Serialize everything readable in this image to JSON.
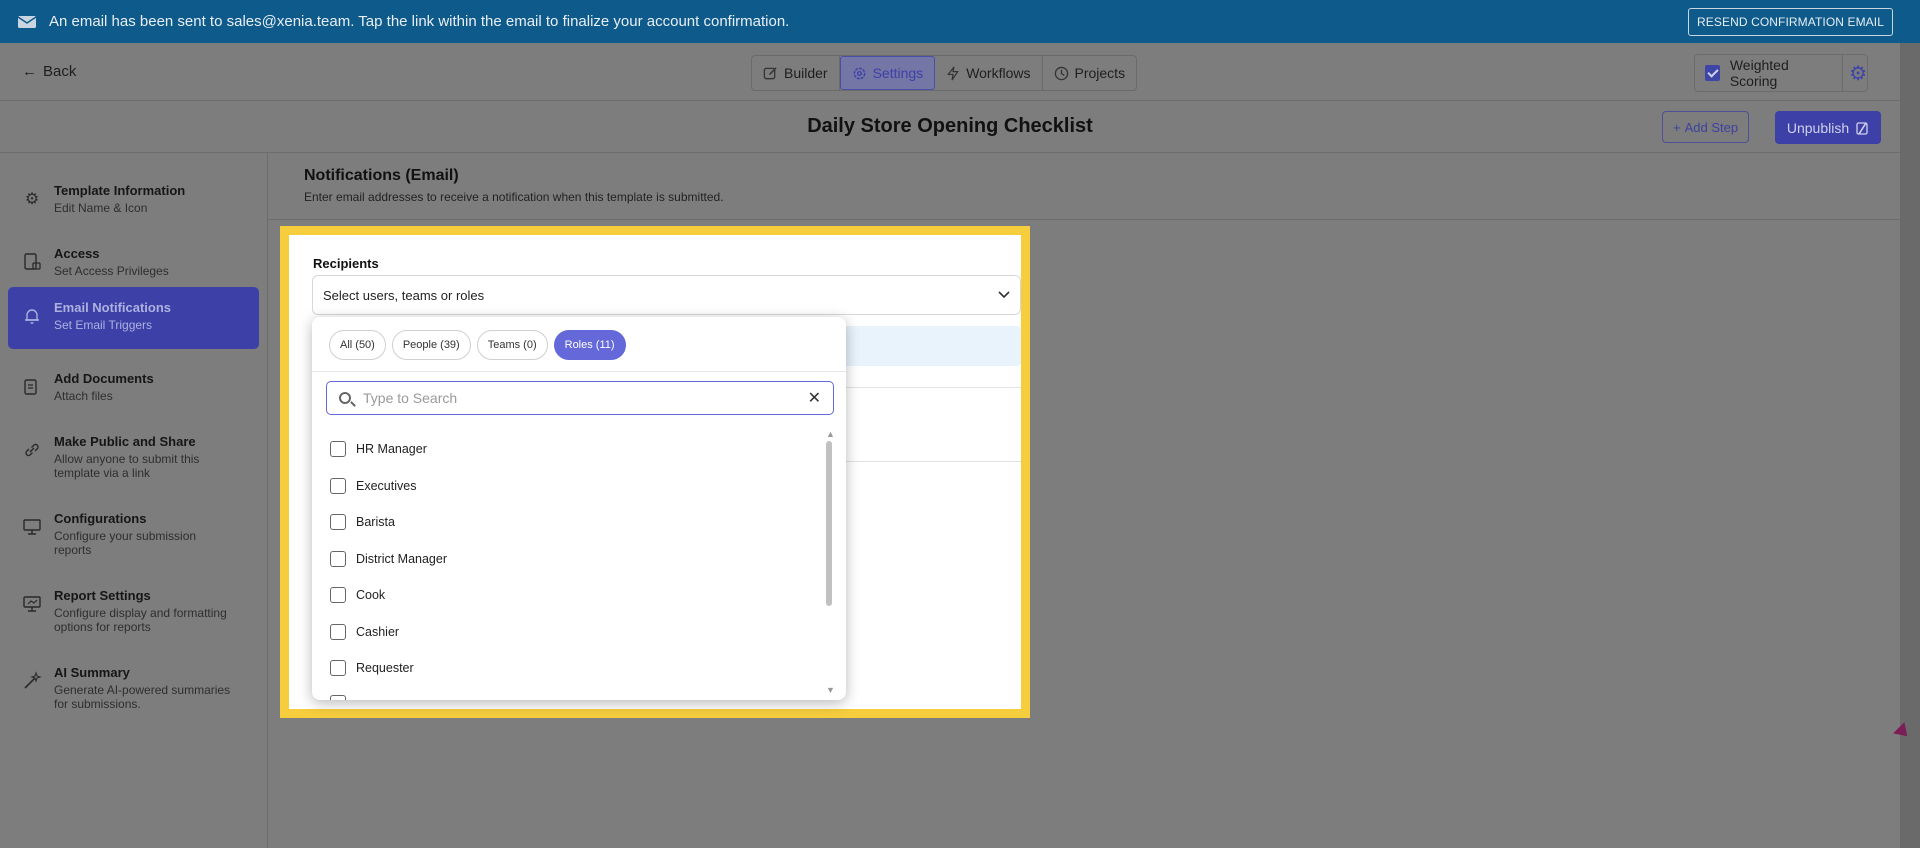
{
  "banner": {
    "message": "An email has been sent to sales@xenia.team. Tap the link within the email to finalize your account confirmation.",
    "resend_label": "RESEND CONFIRMATION EMAIL"
  },
  "topbar": {
    "back_label": "Back",
    "modes": [
      {
        "label": "Builder",
        "icon": "pencil-icon"
      },
      {
        "label": "Settings",
        "icon": "gear-icon",
        "active": true
      },
      {
        "label": "Workflows",
        "icon": "bolt-icon"
      },
      {
        "label": "Projects",
        "icon": "clock-icon"
      }
    ],
    "weighted_label": "Weighted Scoring",
    "weighted_checked": true
  },
  "titlebar": {
    "title": "Daily Store Opening Checklist",
    "add_step_label": "Add Step",
    "unpublish_label": "Unpublish"
  },
  "sidebar": {
    "items": [
      {
        "title": "Template Information",
        "sub": "Edit Name & Icon",
        "icon": "gear-icon"
      },
      {
        "title": "Access",
        "sub": "Set Access Privileges",
        "icon": "document-lock-icon"
      },
      {
        "title": "Email Notifications",
        "sub": "Set Email Triggers",
        "icon": "bell-icon",
        "active": true
      },
      {
        "title": "Add Documents",
        "sub": "Attach files",
        "icon": "documents-icon"
      },
      {
        "title": "Make Public and Share",
        "sub": "Allow anyone to submit this template via a link",
        "icon": "link-icon"
      },
      {
        "title": "Configurations",
        "sub": "Configure your submission reports",
        "icon": "presentation-icon"
      },
      {
        "title": "Report Settings",
        "sub": "Configure display and formatting options for reports",
        "icon": "report-icon"
      },
      {
        "title": "AI Summary",
        "sub": "Generate AI-powered summaries for submissions.",
        "icon": "magic-wand-icon"
      }
    ]
  },
  "main": {
    "title": "Notifications (Email)",
    "subtitle": "Enter email addresses to receive a notification when this template is submitted.",
    "recipients_label": "Recipients",
    "select_placeholder": "Select users, teams or roles"
  },
  "dropdown": {
    "filters": [
      {
        "label": "All (50)"
      },
      {
        "label": "People (39)"
      },
      {
        "label": "Teams (0)"
      },
      {
        "label": "Roles (11)",
        "active": true
      }
    ],
    "search_placeholder": "Type to Search",
    "roles": [
      "HR Manager",
      "Executives",
      "Barista",
      "District Manager",
      "Cook",
      "Cashier",
      "Requester"
    ]
  },
  "colors": {
    "banner": "#0e5a8a",
    "accent": "#3d40a6",
    "highlight": "#f6cd3d",
    "chip_active": "#6468d8"
  }
}
